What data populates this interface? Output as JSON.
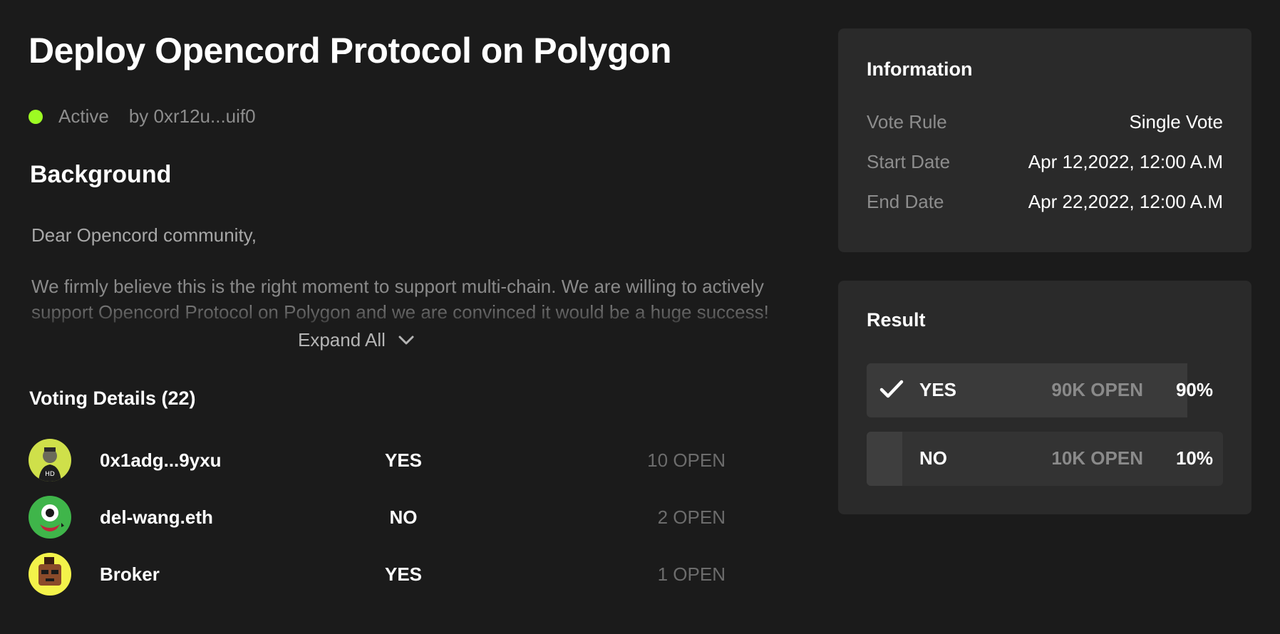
{
  "proposal": {
    "title": "Deploy Opencord Protocol on Polygon",
    "status": "Active",
    "author": "by 0xr12u...uif0"
  },
  "background": {
    "heading": "Background",
    "greeting": "Dear Opencord community,",
    "paragraph": "We firmly believe this is the right moment to support multi-chain.  We are willing to actively support Opencord Protocol on Polygon and we are convinced it would be a huge success!",
    "expand_label": "Expand All"
  },
  "voting": {
    "heading": "Voting Details (22)",
    "rows": [
      {
        "name": "0x1adg...9yxu",
        "choice": "YES",
        "power": "10 OPEN"
      },
      {
        "name": "del-wang.eth",
        "choice": "NO",
        "power": "2 OPEN"
      },
      {
        "name": "Broker",
        "choice": "YES",
        "power": "1 OPEN"
      }
    ]
  },
  "information": {
    "heading": "Information",
    "rows": [
      {
        "label": "Vote Rule",
        "value": "Single Vote"
      },
      {
        "label": "Start Date",
        "value": "Apr 12,2022, 12:00 A.M"
      },
      {
        "label": "End Date",
        "value": "Apr 22,2022, 12:00 A.M"
      }
    ]
  },
  "result": {
    "heading": "Result",
    "options": [
      {
        "label": "YES",
        "amount": "90K OPEN",
        "percent": "90%",
        "fraction": 0.9
      },
      {
        "label": "NO",
        "amount": "10K OPEN",
        "percent": "10%",
        "fraction": 0.1
      }
    ]
  },
  "colors": {
    "active_dot": "#9dfb23",
    "background": "#1b1b1b",
    "card": "#2a2a2a"
  }
}
